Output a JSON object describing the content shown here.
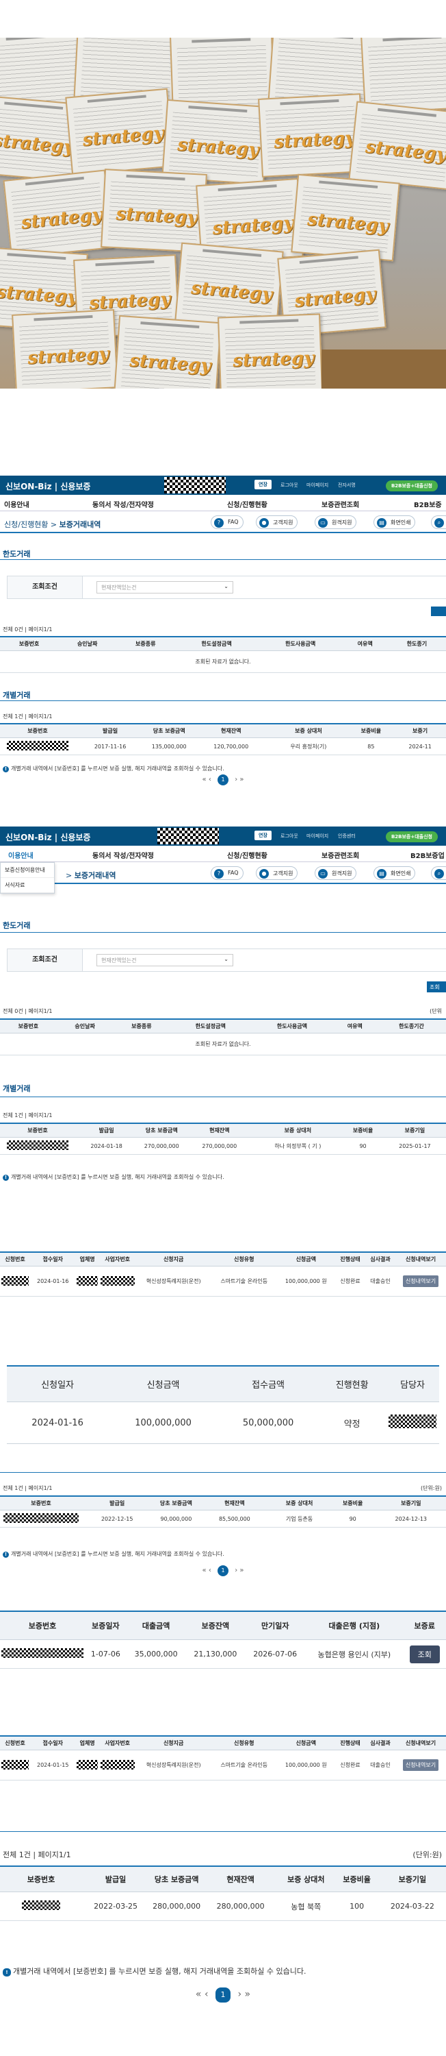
{
  "photo": {
    "paper_word": "strategy"
  },
  "screen1": {
    "brand": "신보ON-Biz",
    "brand_sub": "신용보증",
    "top_links": [
      "로그아웃",
      "마이페이지",
      "전자서명"
    ],
    "top_pill": "연장",
    "green_button": "B2B보증+대출신청",
    "menu": [
      "이용안내",
      "동의서 작성/전자약정",
      "신청/진행현황",
      "보증관련조회",
      "B2B보증"
    ],
    "breadcrumb_home": "신청/진행현황",
    "breadcrumb_current": "보증거래내역",
    "quick": [
      "FAQ",
      "고객지원",
      "원격지원",
      "화면인쇄"
    ],
    "limit_title": "한도거래",
    "filter_label": "조회조건",
    "filter_placeholder": "현재잔액있는건",
    "limit_meta": "전체  0건 | 페이지1/1",
    "limit_headers": [
      "보증번호",
      "승인날짜",
      "보증종류",
      "한도설정금액",
      "한도사용금액",
      "여유액",
      "한도종기"
    ],
    "empty_text": "조회된 자료가 없습니다.",
    "indiv_title": "개별거래",
    "indiv_meta": "전체  1건 | 페이지1/1",
    "indiv_headers": [
      "보증번호",
      "발급일",
      "당초 보증금액",
      "현재잔액",
      "보증 상대처",
      "보증비율",
      "보증기"
    ],
    "indiv_row": [
      "2017-11-16",
      "135,000,000",
      "120,700,000",
      "우리 흥정처(기)",
      "85",
      "2024-11"
    ],
    "note": "개별거래 내역에서 [보증번호] 를 누르시면 보증 실행, 해지 거래내역을 조회하실 수 있습니다.",
    "page": "1"
  },
  "screen2": {
    "brand": "신보ON-Biz",
    "brand_sub": "신용보증",
    "top_pill": "연장",
    "top_links": [
      "로그아웃",
      "마이페이지",
      "인증센터"
    ],
    "green_button": "B2B보증+대출신청",
    "menu": [
      "이용안내",
      "동의서 작성/전자약정",
      "신청/진행현황",
      "보증관련조회",
      "B2B보증업"
    ],
    "dropdown": [
      "보증신청이용안내",
      "서식자료"
    ],
    "breadcrumb_current": "보증거래내역",
    "quick": [
      "FAQ",
      "고객지원",
      "원격지원",
      "화면인쇄"
    ],
    "limit_title": "한도거래",
    "filter_label": "조회조건",
    "filter_placeholder": "현재잔액있는건",
    "search_button": "조회",
    "limit_meta": "전체  0건 | 페이지1/1",
    "unit": "(단위",
    "limit_headers": [
      "보증번호",
      "승인날짜",
      "보증종류",
      "한도설정금액",
      "한도사용금액",
      "여유액",
      "한도종기간"
    ],
    "empty_text": "조회된 자료가 없습니다.",
    "indiv_title": "개별거래",
    "indiv_meta": "전체  1건 | 페이지1/1",
    "indiv_headers": [
      "보증번호",
      "발급일",
      "당초 보증금액",
      "현재잔액",
      "보증 상대처",
      "보증비율",
      "보증기일"
    ],
    "indiv_row": [
      "2024-01-18",
      "270,000,000",
      "270,000,000",
      "하나 의정부쪽 ( 기 )",
      "90",
      "2025-01-17"
    ],
    "note": "개별거래 내역에서 [보증번호] 를 누르시면 보증 실행, 해지 거래내역을 조회하실 수 있습니다."
  },
  "app1": {
    "headers": [
      "신청번호",
      "접수일자",
      "업체명",
      "사업자번호",
      "신청지금",
      "신청유형",
      "신청금액",
      "진행상태",
      "심사결과",
      "신청내역보기"
    ],
    "row": [
      "2024-01-16",
      "혁신성장특례지원(운전)",
      "스마트기술 온라인등",
      "100,000,000 원",
      "신청완료",
      "대출승인",
      "신청내역보기"
    ]
  },
  "summary": {
    "headers": [
      "신청일자",
      "신청금액",
      "접수금액",
      "진행현황",
      "담당자"
    ],
    "row": [
      "2024-01-16",
      "100,000,000",
      "50,000,000",
      "약정"
    ]
  },
  "indiv3": {
    "meta": "전체  1건 | 페이지1/1",
    "unit": "(단위:원)",
    "headers": [
      "보증번호",
      "발급일",
      "당초 보증금액",
      "현재잔액",
      "보증 상대처",
      "보증비율",
      "보증기일"
    ],
    "row": [
      "2022-12-15",
      "90,000,000",
      "85,500,000",
      "기업 등촌동",
      "90",
      "2024-12-13"
    ],
    "note": "개별거래 내역에서 [보증번호] 를 누르시면 보증 실행, 해지 거래내역을 조회하실 수 있습니다.",
    "page": "1"
  },
  "loan": {
    "headers": [
      "보증번호",
      "보증일자",
      "대출금액",
      "보증잔액",
      "만기일자",
      "대출은행 (지점)",
      "보증료"
    ],
    "row": [
      "1-07-06",
      "35,000,000",
      "21,130,000",
      "2026-07-06",
      "농협은행 용인시 (지부)"
    ],
    "button": "조회"
  },
  "app2": {
    "headers": [
      "신청번호",
      "접수일자",
      "업체명",
      "사업자번호",
      "신청지금",
      "신청유형",
      "신청금액",
      "진행상태",
      "심사결과",
      "신청내역보기"
    ],
    "row": [
      "2024-01-15",
      "혁신성장특례지원(운전)",
      "스마트기술 온라인등",
      "100,000,000 원",
      "신청완료",
      "대출승인",
      "신청내역보기"
    ]
  },
  "indiv4": {
    "meta": "전체  1건 | 페이지1/1",
    "unit": "(단위:원)",
    "headers": [
      "보증번호",
      "발급일",
      "당초 보증금액",
      "현재잔액",
      "보증 상대처",
      "보증비율",
      "보증기일"
    ],
    "row": [
      "2022-03-25",
      "280,000,000",
      "280,000,000",
      "농협 북쪽",
      "100",
      "2024-03-22"
    ],
    "note": "개별거래 내역에서 [보증번호] 를 누르시면 보증 실행, 해지 거래내역을 조회하실 수 있습니다.",
    "page": "1"
  },
  "colors": {
    "navy": "#05507f",
    "accent": "#1b75b5",
    "green": "#49b04a"
  }
}
